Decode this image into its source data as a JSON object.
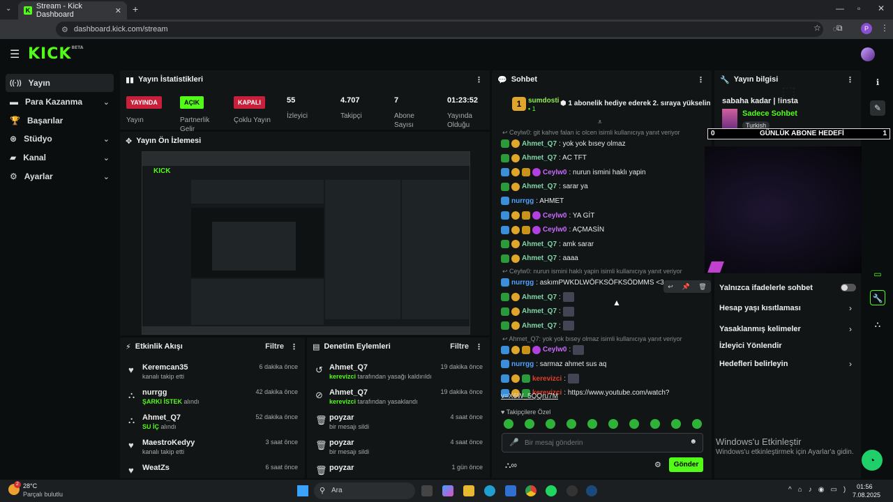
{
  "browser": {
    "tab_title": "Stream - Kick Dashboard",
    "url": "dashboard.kick.com/stream",
    "profile_initial": "P"
  },
  "app": {
    "logo": "KICK",
    "logo_beta": "BETA"
  },
  "sidebar": {
    "items": [
      {
        "label": "Yayın",
        "icon": "broadcast-icon"
      },
      {
        "label": "Para Kazanma",
        "icon": "money-icon"
      },
      {
        "label": "Başarılar",
        "icon": "trophy-icon"
      },
      {
        "label": "Stüdyo",
        "icon": "studio-icon"
      },
      {
        "label": "Kanal",
        "icon": "channel-icon"
      },
      {
        "label": "Ayarlar",
        "icon": "gear-icon"
      }
    ]
  },
  "stats": {
    "title": "Yayın İstatistikleri",
    "items": [
      {
        "badge": "YAYINDA",
        "label": "Yayın",
        "color": "#e0223a"
      },
      {
        "badge": "AÇIK",
        "label": "Partnerlik Gelir",
        "color": "#53fc18"
      },
      {
        "badge": "KAPALI",
        "label": "Çoklu Yayın",
        "color": "#e0223a"
      },
      {
        "value": "55",
        "label": "İzleyici"
      },
      {
        "value": "4.707",
        "label": "Takipçi"
      },
      {
        "value": "7",
        "label": "Abone Sayısı"
      },
      {
        "value": "01:23:52",
        "label": "Yayında Olduğu"
      }
    ]
  },
  "preview": {
    "title": "Yayın Ön İzlemesi"
  },
  "activity": {
    "title": "Etkinlik Akışı",
    "filter": "Filtre",
    "rows": [
      {
        "name": "Keremcan35",
        "pre": "",
        "hl": "",
        "post": "kanalı takip etti",
        "time": "6 dakika önce",
        "icon": "heart-icon"
      },
      {
        "name": "nurrgg",
        "pre": "",
        "hl": "ŞARKI İSTEK",
        "post": " alındı",
        "time": "42 dakika önce",
        "icon": "flow-icon"
      },
      {
        "name": "Ahmet_Q7",
        "pre": "",
        "hl": "SU İÇ",
        "post": " alındı",
        "time": "52 dakika önce",
        "icon": "flow-icon"
      },
      {
        "name": "MaestroKedyy",
        "pre": "",
        "hl": "",
        "post": "kanalı takip etti",
        "time": "3 saat önce",
        "icon": "heart-icon"
      },
      {
        "name": "WeatZs",
        "pre": "",
        "hl": "",
        "post": "",
        "time": "6 saat önce",
        "icon": "heart-icon"
      }
    ]
  },
  "moderation": {
    "title": "Denetim Eylemleri",
    "filter": "Filtre",
    "rows": [
      {
        "name": "Ahmet_Q7",
        "hl": "kerevizci",
        "post": " tarafından yasağı kaldırıldı",
        "time": "19 dakika önce",
        "icon": "undo-icon"
      },
      {
        "name": "Ahmet_Q7",
        "hl": "kerevizci",
        "post": " tarafından yasaklandı",
        "time": "19 dakika önce",
        "icon": "ban-icon"
      },
      {
        "name": "poyzar",
        "hl": "",
        "post": "bir mesajı sildi",
        "time": "4 saat önce",
        "icon": "trash-icon"
      },
      {
        "name": "poyzar",
        "hl": "",
        "post": "bir mesajı sildi",
        "time": "4 saat önce",
        "icon": "trash-icon"
      },
      {
        "name": "poyzar",
        "hl": "",
        "post": "",
        "time": "1 gün önce",
        "icon": "trash-icon"
      }
    ]
  },
  "chat": {
    "title": "Sohbet",
    "pinned": {
      "user": "sumdosti",
      "count": "1",
      "rank": "1",
      "text": "1 abonelik hediye ederek 2. sıraya yükselin"
    },
    "messages": [
      {
        "type": "reply",
        "text": "Ceylw0: git kahve falan ic olcen isimli kullanıcıya yanıt veriyor"
      },
      {
        "user": "Ahmet_Q7",
        "text": ": yok yok bısey olmaz",
        "uc": "u-teal",
        "badges": [
          "b-green",
          "b-gold"
        ]
      },
      {
        "user": "Ahmet_Q7",
        "text": ": AC TFT",
        "uc": "u-teal",
        "badges": [
          "b-green",
          "b-gold"
        ]
      },
      {
        "user": "Ceylw0",
        "text": ": nurun ismini haklı yapin",
        "uc": "u-purple",
        "badges": [
          "b-blue",
          "b-gold",
          "b-crown",
          "b-pink"
        ]
      },
      {
        "user": "Ahmet_Q7",
        "text": ": sarar ya",
        "uc": "u-teal",
        "badges": [
          "b-green",
          "b-gold"
        ]
      },
      {
        "user": "nurrgg",
        "text": ": AHMET",
        "uc": "u-blue",
        "badges": [
          "b-blue"
        ]
      },
      {
        "user": "Ceylw0",
        "text": ": YA GİT",
        "uc": "u-purple",
        "badges": [
          "b-blue",
          "b-gold",
          "b-crown",
          "b-pink"
        ]
      },
      {
        "user": "Ceylw0",
        "text": ": AÇMASİN",
        "uc": "u-purple",
        "badges": [
          "b-blue",
          "b-gold",
          "b-crown",
          "b-pink"
        ]
      },
      {
        "user": "Ahmet_Q7",
        "text": ": amk sarar",
        "uc": "u-teal",
        "badges": [
          "b-green",
          "b-gold"
        ]
      },
      {
        "user": "Ahmet_Q7",
        "text": ": aaaa",
        "uc": "u-teal",
        "badges": [
          "b-green",
          "b-gold"
        ]
      },
      {
        "type": "reply",
        "text": "Ceylw0: nurun ismini haklı yapin isimli kullanıcıya yanıt veriyor"
      },
      {
        "user": "nurrgg",
        "text": ": askımPWKDLWÖFKSÖFKSÖDMMS <3",
        "uc": "u-blue",
        "badges": [
          "b-blue"
        ]
      },
      {
        "user": "Ahmet_Q7",
        "text": ": ",
        "uc": "u-teal",
        "badges": [
          "b-green",
          "b-gold"
        ],
        "emote": true
      },
      {
        "user": "Ahmet_Q7",
        "text": ": ",
        "uc": "u-teal",
        "badges": [
          "b-green",
          "b-gold"
        ],
        "emote": true
      },
      {
        "user": "Ahmet_Q7",
        "text": ": ",
        "uc": "u-teal",
        "badges": [
          "b-green",
          "b-gold"
        ],
        "emote": true
      },
      {
        "type": "reply",
        "text": "Ahmet_Q7: yok yok bısey olmaz isimli kullanıcıya yanıt veriyor"
      },
      {
        "user": "Ceylw0",
        "text": ": ",
        "uc": "u-purple",
        "badges": [
          "b-blue",
          "b-gold",
          "b-crown",
          "b-pink"
        ],
        "emote": true
      },
      {
        "user": "nurrgg",
        "text": ": sarmaz ahmet sus aq",
        "uc": "u-blue",
        "badges": [
          "b-blue"
        ]
      },
      {
        "user": "kerevizci",
        "text": ": ",
        "uc": "u-red",
        "badges": [
          "b-blue",
          "b-gold",
          "b-green"
        ],
        "emote": true
      },
      {
        "user": "kerevizci",
        "text": ": https://www.youtube.com/watch?",
        "uc": "u-red",
        "badges": [
          "b-blue",
          "b-gold",
          "b-green"
        ]
      }
    ],
    "link_cont": "v=X6W_5QQru7M",
    "followers_only": "Takipçilere Özel",
    "input_placeholder": "Bir mesaj gönderin",
    "send": "Gönder"
  },
  "stream_info": {
    "title": "Yayın bilgisi",
    "stream_title": "sabaha kadar | !insta",
    "category": "Sadece Sohbet",
    "tag": "Turkish",
    "goal_left": "0",
    "goal_label": "GÜNLÜK ABONE HEDEFİ",
    "goal_right": "1",
    "settings": [
      {
        "label": "Yalnızca ifadelerle sohbet",
        "kind": "toggle"
      },
      {
        "label": "Hesap yaşı kısıtlaması",
        "kind": "chevron"
      },
      {
        "label": "Yasaklanmış kelimeler",
        "kind": "chevron"
      },
      {
        "label": "İzleyici Yönlendir",
        "kind": "none"
      },
      {
        "label": "Hedefleri belirleyin",
        "kind": "chevron"
      }
    ]
  },
  "windows": {
    "activate_title": "Windows'u Etkinleştir",
    "activate_sub": "Windows'u etkinleştirmek için Ayarlar'a gidin.",
    "weather_temp": "28°C",
    "weather_desc": "Parçalı bulutlu",
    "search": "Ara",
    "time": "01:56",
    "date": "7.08.2025",
    "weather_badge": "2"
  }
}
